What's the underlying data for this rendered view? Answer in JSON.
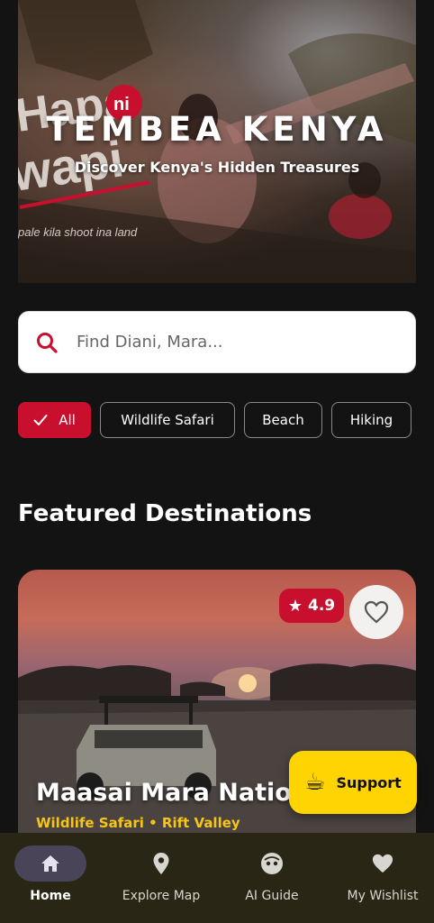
{
  "hero": {
    "title": "TEMBEA KENYA",
    "subtitle": "Discover Kenya's Hidden Treasures",
    "logo_text": "Hapa ni Wapi",
    "tagline": "pale kila shoot ina land"
  },
  "search": {
    "placeholder": "Find Diani, Mara...",
    "value": ""
  },
  "filters": {
    "items": [
      {
        "label": "All",
        "active": true
      },
      {
        "label": "Wildlife Safari",
        "active": false
      },
      {
        "label": "Beach",
        "active": false
      },
      {
        "label": "Hiking",
        "active": false
      }
    ]
  },
  "featured": {
    "title": "Featured Destinations",
    "cards": [
      {
        "name": "Maasai Mara National",
        "category": "Wildlife Safari",
        "region": "Rift Valley",
        "meta": "Wildlife Safari • Rift Valley",
        "rating": "4.9"
      }
    ]
  },
  "support": {
    "label": "Support"
  },
  "nav": {
    "items": [
      {
        "label": "Home",
        "icon": "home-icon",
        "active": true
      },
      {
        "label": "Explore Map",
        "icon": "map-pin-icon",
        "active": false
      },
      {
        "label": "AI Guide",
        "icon": "ai-guide-icon",
        "active": false
      },
      {
        "label": "My Wishlist",
        "icon": "heart-icon",
        "active": false
      }
    ]
  },
  "colors": {
    "background": "#131313",
    "accent_red": "#c8102e",
    "accent_yellow": "#ffd400",
    "meta_yellow": "#f5c518",
    "nav_background": "#2a2616",
    "nav_active_pill": "#4a4458"
  }
}
